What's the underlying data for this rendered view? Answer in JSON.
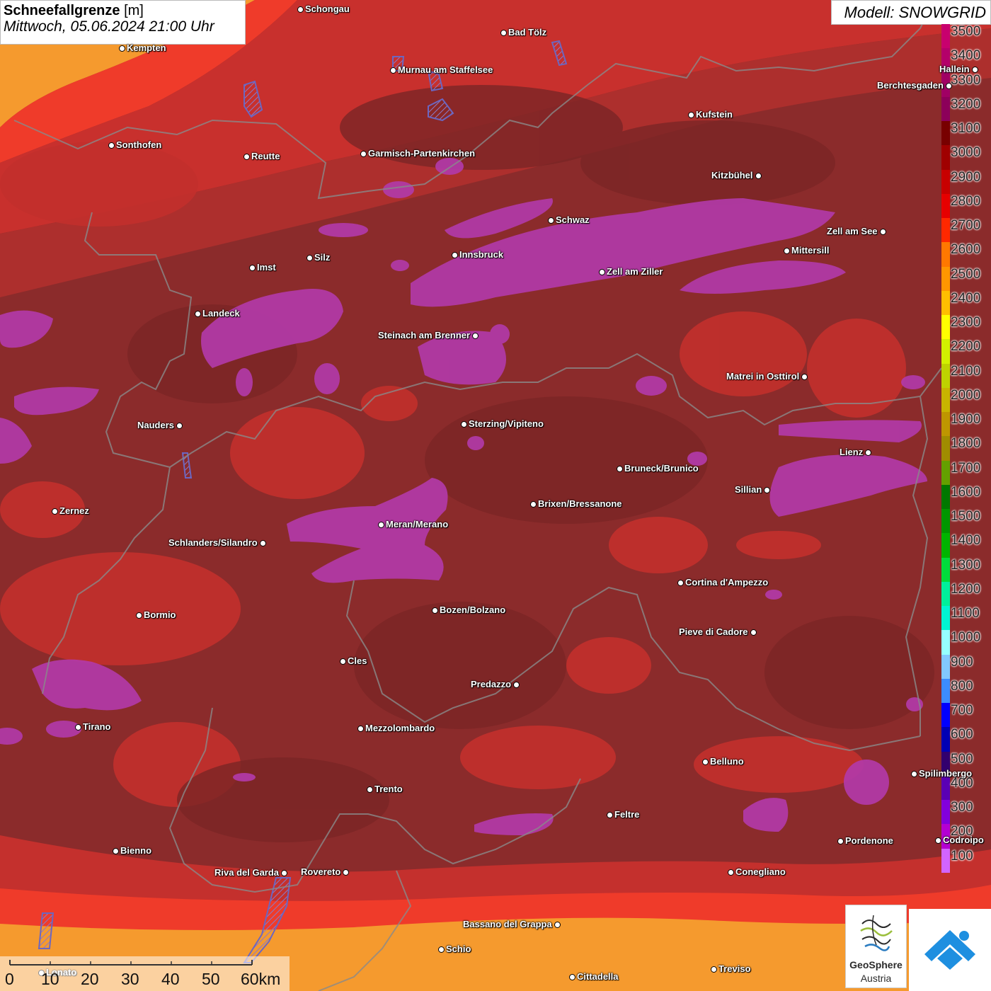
{
  "title": {
    "main": "Schneefallgrenze",
    "unit": "[m]",
    "datetime": "Mittwoch, 05.06.2024 21:00 Uhr"
  },
  "model": "Modell: SNOWGRID",
  "legend": {
    "levels": [
      {
        "value": "3500",
        "color": "#c8006e"
      },
      {
        "value": "3400",
        "color": "#b4006a"
      },
      {
        "value": "3300",
        "color": "#a00064"
      },
      {
        "value": "3200",
        "color": "#8c005a"
      },
      {
        "value": "3100",
        "color": "#780000"
      },
      {
        "value": "3000",
        "color": "#a00000"
      },
      {
        "value": "2900",
        "color": "#c80000"
      },
      {
        "value": "2800",
        "color": "#e60000"
      },
      {
        "value": "2700",
        "color": "#ff2800"
      },
      {
        "value": "2600",
        "color": "#ff7800"
      },
      {
        "value": "2500",
        "color": "#ff9600"
      },
      {
        "value": "2400",
        "color": "#ffbe00"
      },
      {
        "value": "2300",
        "color": "#ffff00"
      },
      {
        "value": "2200",
        "color": "#d2f000"
      },
      {
        "value": "2100",
        "color": "#bed200"
      },
      {
        "value": "2000",
        "color": "#c8b400"
      },
      {
        "value": "1900",
        "color": "#be9600"
      },
      {
        "value": "1800",
        "color": "#a08c00"
      },
      {
        "value": "1700",
        "color": "#64a000"
      },
      {
        "value": "1600",
        "color": "#007800"
      },
      {
        "value": "1500",
        "color": "#009600"
      },
      {
        "value": "1400",
        "color": "#00b400"
      },
      {
        "value": "1300",
        "color": "#00dc3c"
      },
      {
        "value": "1200",
        "color": "#00f09b"
      },
      {
        "value": "1100",
        "color": "#00f5d2"
      },
      {
        "value": "1000",
        "color": "#96ffff"
      },
      {
        "value": "900",
        "color": "#82c8ff"
      },
      {
        "value": "800",
        "color": "#3c8cff"
      },
      {
        "value": "700",
        "color": "#0000ff"
      },
      {
        "value": "600",
        "color": "#0000b4"
      },
      {
        "value": "500",
        "color": "#32006e"
      },
      {
        "value": "400",
        "color": "#5a00b4"
      },
      {
        "value": "300",
        "color": "#8200dc"
      },
      {
        "value": "200",
        "color": "#b400d2"
      },
      {
        "value": "100",
        "color": "#d264ff"
      }
    ]
  },
  "scale_bar": [
    "0",
    "10",
    "20",
    "30",
    "40",
    "50",
    "60km"
  ],
  "cities": [
    {
      "name": "Schongau"
    },
    {
      "name": "Bad Tölz"
    },
    {
      "name": "Kempten"
    },
    {
      "name": "Murnau am Staffelsee"
    },
    {
      "name": "Hallein"
    },
    {
      "name": "Berchtesgaden"
    },
    {
      "name": "Kufstein"
    },
    {
      "name": "Sonthofen"
    },
    {
      "name": "Reutte"
    },
    {
      "name": "Garmisch-Partenkirchen"
    },
    {
      "name": "Kitzbühel"
    },
    {
      "name": "Schwaz"
    },
    {
      "name": "Zell am See"
    },
    {
      "name": "Innsbruck"
    },
    {
      "name": "Mittersill"
    },
    {
      "name": "Silz"
    },
    {
      "name": "Imst"
    },
    {
      "name": "Zell am Ziller"
    },
    {
      "name": "Landeck"
    },
    {
      "name": "Steinach am Brenner"
    },
    {
      "name": "Matrei in Osttirol"
    },
    {
      "name": "Nauders"
    },
    {
      "name": "Sterzing/Vipiteno"
    },
    {
      "name": "Lienz"
    },
    {
      "name": "Bruneck/Brunico"
    },
    {
      "name": "Sillian"
    },
    {
      "name": "Zernez"
    },
    {
      "name": "Brixen/Bressanone"
    },
    {
      "name": "Meran/Merano"
    },
    {
      "name": "Schlanders/Silandro"
    },
    {
      "name": "Cortina d'Ampezzo"
    },
    {
      "name": "Bozen/Bolzano"
    },
    {
      "name": "Bormio"
    },
    {
      "name": "Pieve di Cadore"
    },
    {
      "name": "Cles"
    },
    {
      "name": "Predazzo"
    },
    {
      "name": "Tirano"
    },
    {
      "name": "Mezzolombardo"
    },
    {
      "name": "Belluno"
    },
    {
      "name": "Spilimbergo"
    },
    {
      "name": "Trento"
    },
    {
      "name": "Feltre"
    },
    {
      "name": "Pordenone"
    },
    {
      "name": "Codroipo"
    },
    {
      "name": "Bienno"
    },
    {
      "name": "Riva del Garda"
    },
    {
      "name": "Rovereto"
    },
    {
      "name": "Conegliano"
    },
    {
      "name": "Bassano del Grappa"
    },
    {
      "name": "Schio"
    },
    {
      "name": "Treviso"
    },
    {
      "name": "Cittadella"
    },
    {
      "name": "Lonato"
    }
  ],
  "logos": {
    "geosphere_line1": "GeoSphere",
    "geosphere_line2": "Austria"
  }
}
